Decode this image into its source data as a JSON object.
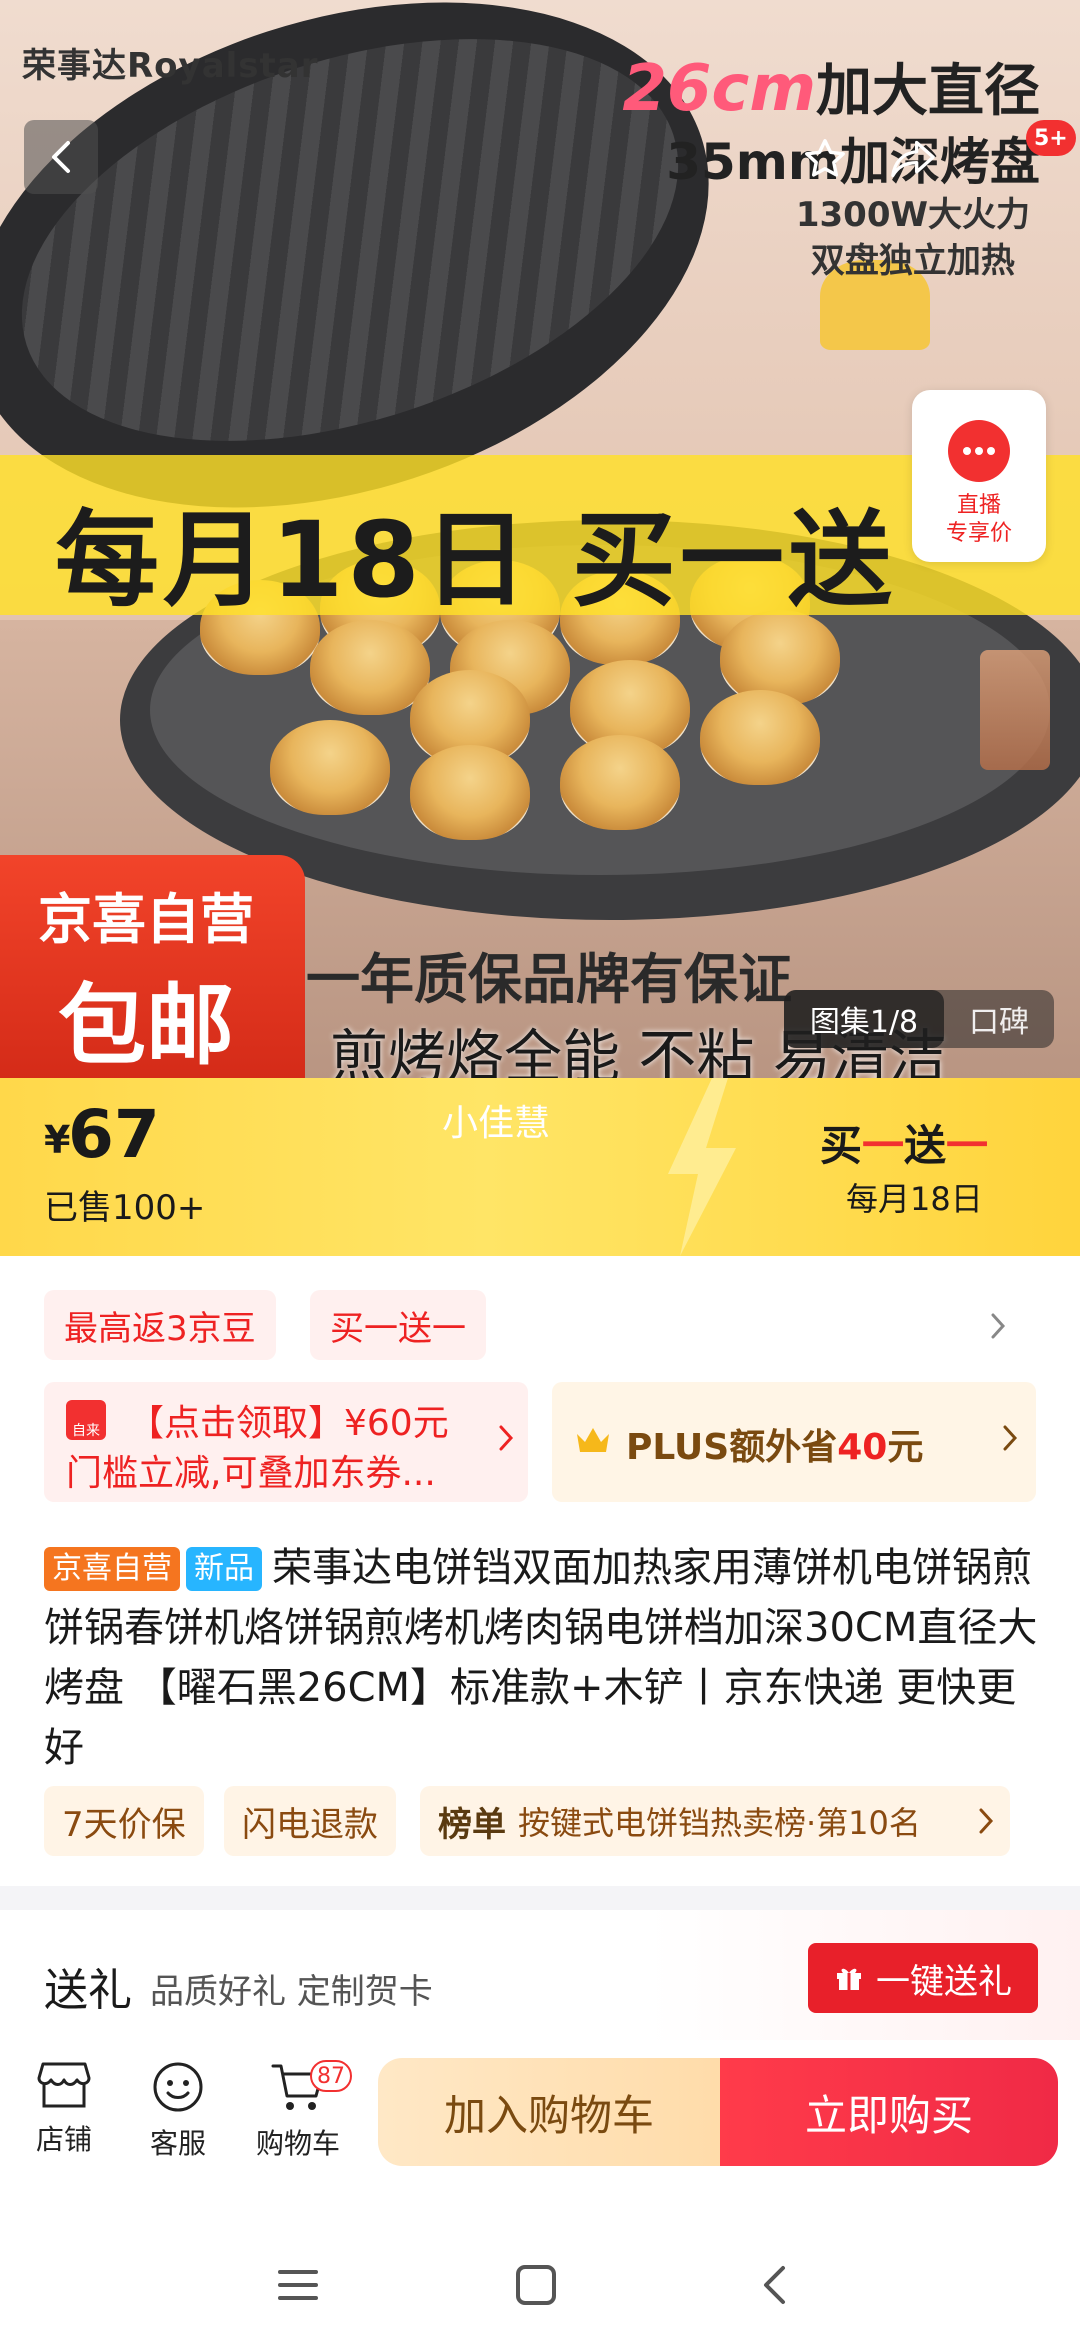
{
  "hero": {
    "brand": "荣事达Royalstar",
    "promo_size": "26cm",
    "promo_size_suffix": "加大直径",
    "promo_depth": "35mm加深烤盘",
    "promo_power": "1300W大火力",
    "promo_dual": "双盘独立加热",
    "banner": "每月18日 买一送",
    "badge_top": "京喜自营",
    "badge_bottom": "包邮",
    "warranty": "一年质保品牌有保证",
    "nonstick": "煎烤烙全能 不粘 易清洁",
    "share_badge": "5+",
    "live_label_1": "直播",
    "live_label_2": "专享价",
    "gallery_label": "图集1/8",
    "reviews_label": "口碑",
    "icons": [
      "back-icon",
      "star-icon",
      "share-icon",
      "live-icon"
    ]
  },
  "price_bar": {
    "currency": "¥",
    "price": "67",
    "sold": "已售100+",
    "host": "小佳慧",
    "promo_b1": "买",
    "promo_dash1": "一",
    "promo_b2": "送",
    "promo_dash2": "一",
    "promo_date": "每月18日"
  },
  "promo_chips": [
    "最高返3京豆",
    "买一送一"
  ],
  "coupon_left": {
    "icon_text": "自来",
    "line1": "【点击领取】¥60元",
    "line2": "门槛立减,可叠加东券..."
  },
  "coupon_right": {
    "prefix": "PLUS额外省",
    "amount": "40",
    "suffix": "元"
  },
  "product": {
    "tag_store": "京喜自营",
    "tag_new": "新品",
    "title": "荣事达电饼铛双面加热家用薄饼机电饼锅煎饼锅春饼机烙饼锅煎烤机烤肉锅电饼档加深30CM直径大烤盘 【曜石黑26CM】标准款+木铲丨京东快递 更快更好"
  },
  "services": {
    "price_protect": "7天价保",
    "fast_refund": "闪电退款",
    "rank_label": "榜单",
    "rank_text": "按键式电饼铛热卖榜·第10名"
  },
  "gift": {
    "title": "送礼",
    "subtitle": "品质好礼 定制贺卡",
    "button": "一键送礼"
  },
  "action_bar": {
    "store": "店铺",
    "service": "客服",
    "cart": "购物车",
    "cart_count": "87",
    "add_to_cart": "加入购物车",
    "buy_now": "立即购买"
  },
  "colors": {
    "accent_red": "#f23030",
    "price_yellow": "#ffd84a",
    "buy_red": "#f02a46"
  }
}
